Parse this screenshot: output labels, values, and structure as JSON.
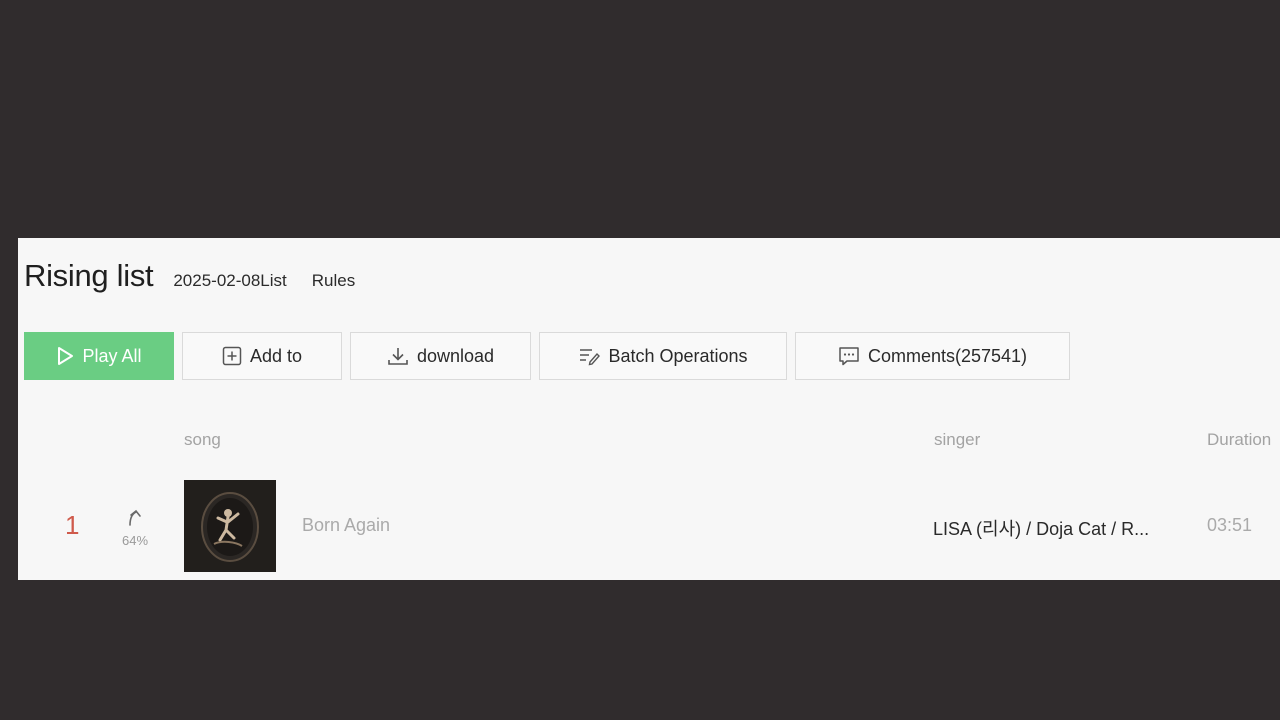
{
  "header": {
    "title": "Rising list",
    "date_label": "2025-02-08List",
    "rules_label": "Rules"
  },
  "toolbar": {
    "play_all": {
      "label": "Play All",
      "icon": "play-icon"
    },
    "add_to": {
      "label": "Add to",
      "icon": "plus-square-icon"
    },
    "download": {
      "label": "download",
      "icon": "download-icon"
    },
    "batch": {
      "label": "Batch Operations",
      "icon": "batch-edit-icon"
    },
    "comments": {
      "label": "Comments(257541)",
      "icon": "comment-icon"
    }
  },
  "table": {
    "headers": {
      "song": "song",
      "singer": "singer",
      "duration": "Duration"
    },
    "rows": [
      {
        "rank": "1",
        "trend_icon": "arrow-up-icon",
        "trend_percent": "64%",
        "song": "Born Again",
        "singer": "LISA (리사) / Doja Cat / R...",
        "duration": "03:51"
      }
    ]
  },
  "colors": {
    "background": "#302c2d",
    "panel": "#f7f7f7",
    "accent_green": "#6acd83",
    "rank_red": "#cf5a4b"
  }
}
